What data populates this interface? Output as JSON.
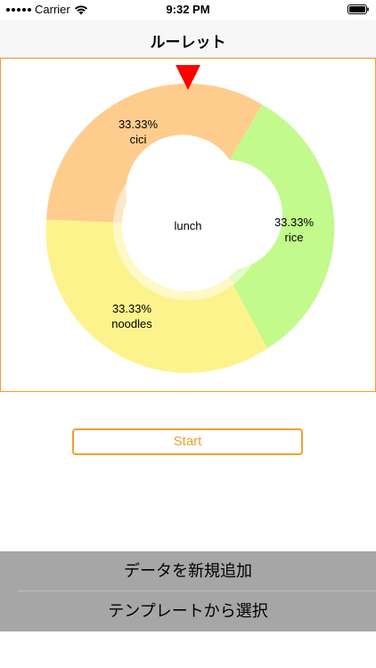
{
  "status_bar": {
    "carrier": "Carrier",
    "time": "9:32 PM"
  },
  "nav": {
    "title": "ルーレット"
  },
  "roulette": {
    "center_label": "lunch",
    "colors": {
      "frame": "#f0a030",
      "pointer": "#ff0000"
    },
    "segments": [
      {
        "percent": "33.33%",
        "name": "rice",
        "color": "#c2fa8c"
      },
      {
        "percent": "33.33%",
        "name": "noodles",
        "color": "#fdf38d"
      },
      {
        "percent": "33.33%",
        "name": "cici",
        "color": "#fecd8e"
      }
    ]
  },
  "start_button": {
    "label": "Start"
  },
  "actions": {
    "add_new": "データを新規追加",
    "from_template": "テンプレートから選択"
  }
}
